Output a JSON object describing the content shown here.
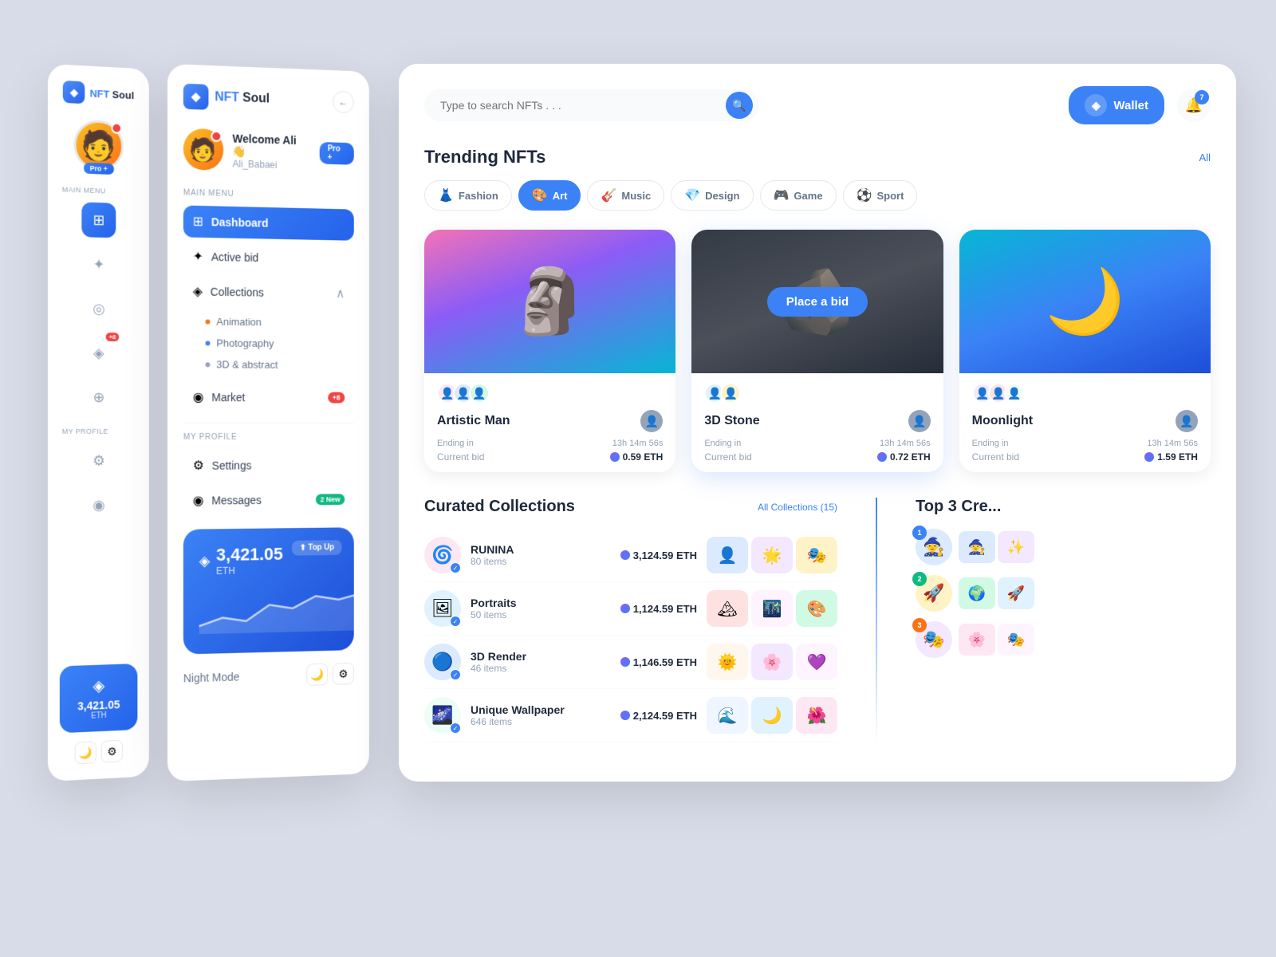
{
  "app": {
    "name": "NFT Soul",
    "name_nft": "NFT",
    "name_soul": "Soul"
  },
  "narrow_sidebar": {
    "logo": "◆",
    "avatar_emoji": "🧑",
    "pro_label": "Pro +",
    "notification_count": "",
    "main_menu_label": "Main Menu",
    "nav_items": [
      {
        "icon": "⊞",
        "active": true
      },
      {
        "icon": "✦",
        "active": false
      },
      {
        "icon": "◎",
        "active": false
      },
      {
        "icon": "◈",
        "active": false,
        "badge": "+8"
      },
      {
        "icon": "⊕",
        "active": false
      }
    ],
    "my_profile_label": "My Profile",
    "profile_items": [
      {
        "icon": "⚙"
      },
      {
        "icon": "◉"
      }
    ],
    "wallet_amount": "3,421.05",
    "wallet_currency": "ETH",
    "toggle_moon": "🌙",
    "toggle_gear": "⚙"
  },
  "wide_sidebar": {
    "logo": "◆",
    "back_icon": "←",
    "user_name": "Welcome Ali 👋",
    "user_username": "Ali_Babaei",
    "user_avatar": "🧑",
    "pro_label": "Pro +",
    "main_menu_label": "Main Menu",
    "nav_items": [
      {
        "icon": "⊞",
        "label": "Dashboard",
        "active": true
      },
      {
        "icon": "✦",
        "label": "Active bid",
        "active": false
      },
      {
        "icon": "◈",
        "label": "Collections",
        "active": false,
        "expand": true
      },
      {
        "icon": "◉",
        "label": "Market",
        "active": false,
        "badge": "+8"
      }
    ],
    "collections_sub": [
      {
        "label": "Animation",
        "dot": "orange"
      },
      {
        "label": "Photography",
        "dot": "blue"
      },
      {
        "label": "3D & abstract",
        "dot": "gray"
      }
    ],
    "my_profile_label": "My Profile",
    "profile_items": [
      {
        "icon": "⚙",
        "label": "Settings"
      },
      {
        "icon": "◉",
        "label": "Messages",
        "badge": "2 New",
        "badge_green": true
      }
    ],
    "wallet_amount": "3,421.05",
    "wallet_currency": "ETH",
    "topup_label": "⬆ Top Up",
    "night_mode_label": "Night Mode",
    "toggle_moon": "🌙",
    "toggle_gear": "⚙"
  },
  "main": {
    "search_placeholder": "Type to search NFTs . . .",
    "wallet_label": "Wallet",
    "notification_count": "7",
    "trending_title": "Trending NFTs",
    "see_all": "All",
    "categories": [
      {
        "label": "Fashion",
        "icon": "👗",
        "active": false
      },
      {
        "label": "Art",
        "icon": "🎨",
        "active": true
      },
      {
        "label": "Music",
        "icon": "🎸",
        "active": false
      },
      {
        "label": "Design",
        "icon": "💎",
        "active": false
      },
      {
        "label": "Game",
        "icon": "🎮",
        "active": false
      },
      {
        "label": "Sport",
        "icon": "⚽",
        "active": false
      }
    ],
    "nft_cards": [
      {
        "name": "Artistic Man",
        "ending_label": "Ending in",
        "time": "13h 14m 56s",
        "bid_label": "Current bid",
        "bid_value": "0.59 ETH",
        "bg": "art1"
      },
      {
        "name": "3D Stone",
        "ending_label": "Ending in",
        "time": "13h 14m 56s",
        "bid_label": "Current bid",
        "bid_value": "0.72 ETH",
        "bg": "art2",
        "show_bid": true
      },
      {
        "name": "Moonlight",
        "ending_label": "Ending in",
        "time": "13h 14m 56s",
        "bid_label": "Current bid",
        "bid_value": "1.59 ETH",
        "bg": "art3"
      }
    ],
    "place_bid_label": "Place a bid",
    "collections_title": "Curated Collections",
    "all_collections": "All Collections (15)",
    "collections": [
      {
        "name": "RUNINA",
        "count": "80 items",
        "price": "3,124.59 ETH",
        "emoji": "🌀"
      },
      {
        "name": "Portraits",
        "count": "50 items",
        "price": "1,124.59 ETH",
        "emoji": "🖼"
      },
      {
        "name": "3D Render",
        "count": "46 items",
        "price": "1,146.59 ETH",
        "emoji": "🔵"
      },
      {
        "name": "Unique Wallpaper",
        "count": "646 items",
        "price": "2,124.59 ETH",
        "emoji": "🌌"
      }
    ],
    "top_creators_title": "Top 3 Cre...",
    "top_creators": [
      {
        "rank": "1",
        "emoji": "🧙"
      },
      {
        "rank": "2",
        "emoji": "🚀"
      },
      {
        "rank": "3",
        "emoji": "🎭"
      }
    ]
  }
}
